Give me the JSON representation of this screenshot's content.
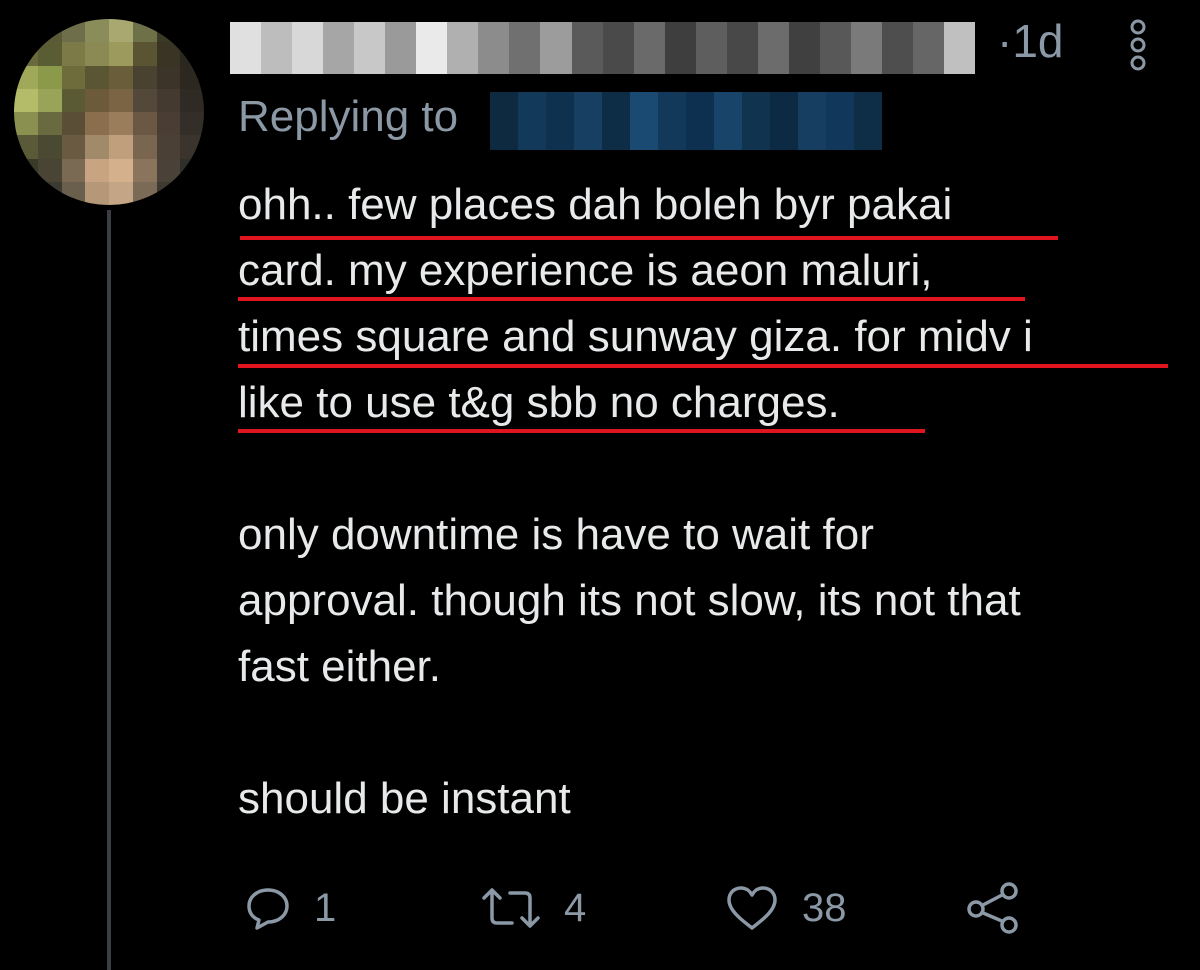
{
  "tweet": {
    "time_prefix": "·",
    "time": "1d",
    "replying_label": "Replying to",
    "body_lines": [
      "ohh.. few places dah boleh byr pakai",
      "card. my experience is aeon maluri,",
      "times square and sunway giza. for midv i",
      "like to use t&g sbb no charges.",
      "",
      "only downtime is have to wait for",
      "approval. though its not slow, its not that",
      "fast either.",
      "",
      "should be instant"
    ]
  },
  "actions": {
    "reply": {
      "icon": "reply-icon",
      "count": "1"
    },
    "retweet": {
      "icon": "retweet-icon",
      "count": "4"
    },
    "like": {
      "icon": "heart-icon",
      "count": "38"
    },
    "share": {
      "icon": "share-icon"
    }
  },
  "colors": {
    "background": "#000000",
    "text": "#e7e9ea",
    "secondary": "#8b98a5",
    "underline": "#e0151f",
    "thread_line": "#3a3d42"
  }
}
